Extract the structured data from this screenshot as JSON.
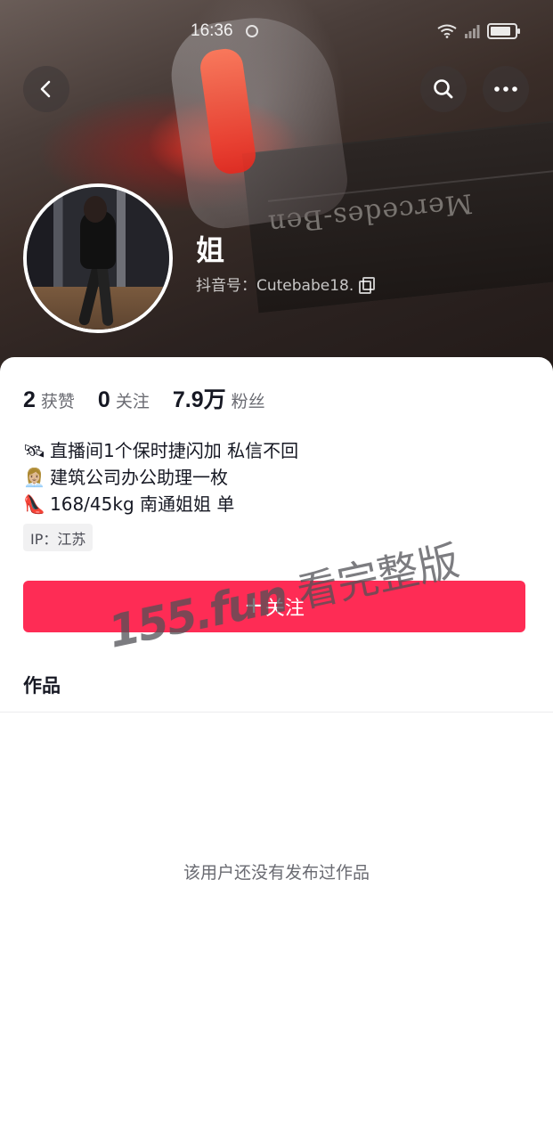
{
  "status_bar": {
    "time": "16:36"
  },
  "cover": {
    "plate_text": "Mercedes-Ben"
  },
  "profile": {
    "nickname": "姐",
    "douyin_id": "抖音号：Cutebabe18."
  },
  "stats": {
    "likes": {
      "value": "2",
      "label": "获赞"
    },
    "following": {
      "value": "0",
      "label": "关注"
    },
    "followers": {
      "value": "7.9万",
      "label": "粉丝"
    }
  },
  "bio": {
    "lines": [
      {
        "emoji": "🛰",
        "text": "直播间1个保时捷闪加 私信不回"
      },
      {
        "emoji": "👩🏼‍💼",
        "text": "建筑公司办公助理一枚"
      },
      {
        "emoji": "👠",
        "text": "168/45kg 南通姐姐 单"
      }
    ]
  },
  "ip_location": "IP：江苏",
  "follow_button": {
    "label": "关注",
    "color": "#fe2c55"
  },
  "tabs": {
    "works": "作品"
  },
  "empty_state": "该用户还没有发布过作品",
  "watermark": {
    "site": "155.fun",
    "text": "看完整版"
  },
  "icons": [
    "back-arrow-icon",
    "search-icon",
    "more-icon",
    "copy-icon",
    "wifi-icon",
    "signal-icon",
    "battery-icon",
    "plus-icon"
  ]
}
